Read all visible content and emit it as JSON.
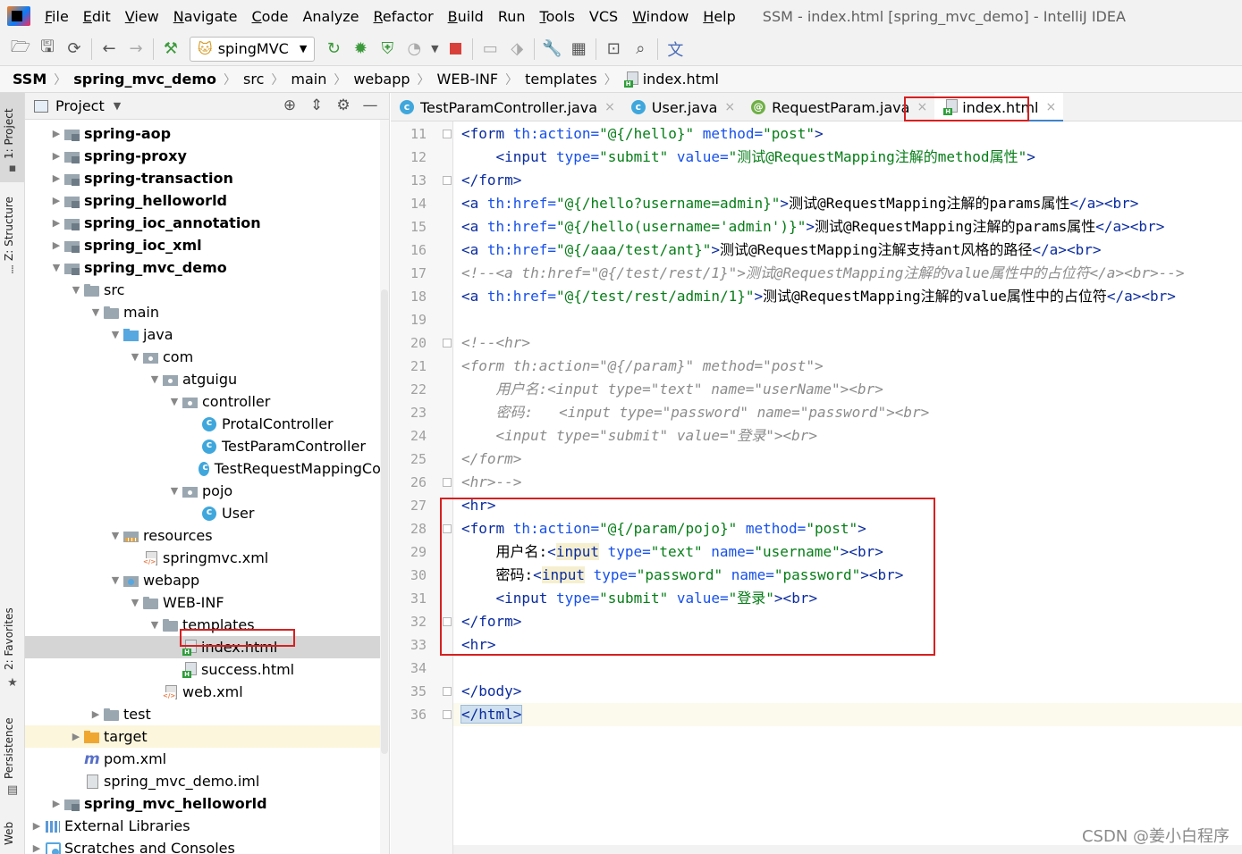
{
  "menubar": {
    "items": [
      {
        "label": "File",
        "u": "F",
        "rest": "ile"
      },
      {
        "label": "Edit",
        "u": "E",
        "rest": "dit"
      },
      {
        "label": "View",
        "u": "V",
        "rest": "iew"
      },
      {
        "label": "Navigate",
        "u": "N",
        "rest": "avigate"
      },
      {
        "label": "Code",
        "u": "C",
        "rest": "ode"
      },
      {
        "label": "Analyze",
        "u": "",
        "rest": "Analyze"
      },
      {
        "label": "Refactor",
        "u": "R",
        "rest": "efactor"
      },
      {
        "label": "Build",
        "u": "B",
        "rest": "uild"
      },
      {
        "label": "Run",
        "u": "",
        "rest": "Run"
      },
      {
        "label": "Tools",
        "u": "T",
        "rest": "ools"
      },
      {
        "label": "VCS",
        "u": "",
        "rest": "VCS"
      },
      {
        "label": "Window",
        "u": "W",
        "rest": "indow"
      },
      {
        "label": "Help",
        "u": "H",
        "rest": "elp"
      }
    ],
    "window_title": "SSM - index.html [spring_mvc_demo] - IntelliJ IDEA"
  },
  "toolbar": {
    "run_config": "spingMVC"
  },
  "breadcrumb": [
    "SSM",
    "spring_mvc_demo",
    "src",
    "main",
    "webapp",
    "WEB-INF",
    "templates",
    "index.html"
  ],
  "left_strip": {
    "project": "1: Project",
    "structure": "Z: Structure",
    "favorites": "2: Favorites",
    "persistence": "Persistence",
    "web": "Web"
  },
  "project_panel": {
    "title": "Project",
    "tree": [
      {
        "label": "spring-aop",
        "depth": 1,
        "arrow": "right",
        "icon": "module",
        "bold": true
      },
      {
        "label": "spring-proxy",
        "depth": 1,
        "arrow": "right",
        "icon": "module",
        "bold": true
      },
      {
        "label": "spring-transaction",
        "depth": 1,
        "arrow": "right",
        "icon": "module",
        "bold": true
      },
      {
        "label": "spring_helloworld",
        "depth": 1,
        "arrow": "right",
        "icon": "module",
        "bold": true
      },
      {
        "label": "spring_ioc_annotation",
        "depth": 1,
        "arrow": "right",
        "icon": "module",
        "bold": true
      },
      {
        "label": "spring_ioc_xml",
        "depth": 1,
        "arrow": "right",
        "icon": "module",
        "bold": true
      },
      {
        "label": "spring_mvc_demo",
        "depth": 1,
        "arrow": "down",
        "icon": "module",
        "bold": true
      },
      {
        "label": "src",
        "depth": 2,
        "arrow": "down",
        "icon": "folder"
      },
      {
        "label": "main",
        "depth": 3,
        "arrow": "down",
        "icon": "folder"
      },
      {
        "label": "java",
        "depth": 4,
        "arrow": "down",
        "icon": "javafolder"
      },
      {
        "label": "com",
        "depth": 5,
        "arrow": "down",
        "icon": "pkg"
      },
      {
        "label": "atguigu",
        "depth": 6,
        "arrow": "down",
        "icon": "pkg"
      },
      {
        "label": "controller",
        "depth": 7,
        "arrow": "down",
        "icon": "pkg"
      },
      {
        "label": "ProtalController",
        "depth": 8,
        "arrow": "",
        "icon": "cls"
      },
      {
        "label": "TestParamController",
        "depth": 8,
        "arrow": "",
        "icon": "cls"
      },
      {
        "label": "TestRequestMappingCon",
        "depth": 8,
        "arrow": "",
        "icon": "cls"
      },
      {
        "label": "pojo",
        "depth": 7,
        "arrow": "down",
        "icon": "pkg"
      },
      {
        "label": "User",
        "depth": 8,
        "arrow": "",
        "icon": "cls"
      },
      {
        "label": "resources",
        "depth": 4,
        "arrow": "down",
        "icon": "res"
      },
      {
        "label": "springmvc.xml",
        "depth": 5,
        "arrow": "",
        "icon": "xml"
      },
      {
        "label": "webapp",
        "depth": 4,
        "arrow": "down",
        "icon": "webapp"
      },
      {
        "label": "WEB-INF",
        "depth": 5,
        "arrow": "down",
        "icon": "folder"
      },
      {
        "label": "templates",
        "depth": 6,
        "arrow": "down",
        "icon": "folder"
      },
      {
        "label": "index.html",
        "depth": 7,
        "arrow": "",
        "icon": "html",
        "selected": true
      },
      {
        "label": "success.html",
        "depth": 7,
        "arrow": "",
        "icon": "html"
      },
      {
        "label": "web.xml",
        "depth": 6,
        "arrow": "",
        "icon": "xml"
      },
      {
        "label": "test",
        "depth": 3,
        "arrow": "right",
        "icon": "folder"
      },
      {
        "label": "target",
        "depth": 2,
        "arrow": "right",
        "icon": "target-folder",
        "highlight": true
      },
      {
        "label": "pom.xml",
        "depth": 2,
        "arrow": "",
        "icon": "pom"
      },
      {
        "label": "spring_mvc_demo.iml",
        "depth": 2,
        "arrow": "",
        "icon": "iml"
      },
      {
        "label": "spring_mvc_helloworld",
        "depth": 1,
        "arrow": "right",
        "icon": "module",
        "bold": true
      },
      {
        "label": "External Libraries",
        "depth": 0,
        "arrow": "right",
        "icon": "libs"
      },
      {
        "label": "Scratches and Consoles",
        "depth": 0,
        "arrow": "right",
        "icon": "scratch"
      }
    ]
  },
  "editor_tabs": [
    {
      "label": "TestParamController.java",
      "icon": "class"
    },
    {
      "label": "User.java",
      "icon": "class"
    },
    {
      "label": "RequestParam.java",
      "icon": "annotation"
    },
    {
      "label": "index.html",
      "icon": "html",
      "active": true
    }
  ],
  "code_lines": [
    {
      "num": "11",
      "segs": [
        [
          "tag",
          "<form "
        ],
        [
          "attr",
          "th:action="
        ],
        [
          "val",
          "\"@{/hello}\""
        ],
        [
          "attr",
          " method="
        ],
        [
          "val",
          "\"post\""
        ],
        [
          "tag",
          ">"
        ]
      ]
    },
    {
      "num": "12",
      "segs": [
        [
          "txt",
          "    "
        ],
        [
          "tag",
          "<input "
        ],
        [
          "attr",
          "type="
        ],
        [
          "val",
          "\"submit\""
        ],
        [
          "attr",
          " value="
        ],
        [
          "val",
          "\"测试@RequestMapping注解的method属性\""
        ],
        [
          "tag",
          ">"
        ]
      ]
    },
    {
      "num": "13",
      "segs": [
        [
          "tag",
          "</form>"
        ]
      ]
    },
    {
      "num": "14",
      "segs": [
        [
          "tag",
          "<a "
        ],
        [
          "attr",
          "th:href="
        ],
        [
          "val",
          "\"@{/hello?username=admin}\""
        ],
        [
          "tag",
          ">"
        ],
        [
          "txt",
          "测试@RequestMapping注解的params属性"
        ],
        [
          "tag",
          "</a><br>"
        ]
      ]
    },
    {
      "num": "15",
      "segs": [
        [
          "tag",
          "<a "
        ],
        [
          "attr",
          "th:href="
        ],
        [
          "val",
          "\"@{/hello(username='admin')}\""
        ],
        [
          "tag",
          ">"
        ],
        [
          "txt",
          "测试@RequestMapping注解的params属性"
        ],
        [
          "tag",
          "</a><br>"
        ]
      ]
    },
    {
      "num": "16",
      "segs": [
        [
          "tag",
          "<a "
        ],
        [
          "attr",
          "th:href="
        ],
        [
          "val",
          "\"@{/aaa/test/ant}\""
        ],
        [
          "tag",
          ">"
        ],
        [
          "txt",
          "测试@RequestMapping注解支持ant风格的路径"
        ],
        [
          "tag",
          "</a><br>"
        ]
      ]
    },
    {
      "num": "17",
      "segs": [
        [
          "cmt",
          "<!--<a th:href=\"@{/test/rest/1}\">测试@RequestMapping注解的value属性中的占位符</a><br>-->"
        ]
      ]
    },
    {
      "num": "18",
      "segs": [
        [
          "tag",
          "<a "
        ],
        [
          "attr",
          "th:href="
        ],
        [
          "val",
          "\"@{/test/rest/admin/1}\""
        ],
        [
          "tag",
          ">"
        ],
        [
          "txt",
          "测试@RequestMapping注解的value属性中的占位符"
        ],
        [
          "tag",
          "</a><br>"
        ]
      ]
    },
    {
      "num": "19",
      "segs": []
    },
    {
      "num": "20",
      "segs": [
        [
          "cmt",
          "<!--<hr>"
        ]
      ]
    },
    {
      "num": "21",
      "segs": [
        [
          "cmt",
          "<form th:action=\"@{/param}\" method=\"post\">"
        ]
      ]
    },
    {
      "num": "22",
      "segs": [
        [
          "cmt",
          "    用户名:<input type=\"text\" name=\"userName\"><br>"
        ]
      ]
    },
    {
      "num": "23",
      "segs": [
        [
          "cmt",
          "    密码:   <input type=\"password\" name=\"password\"><br>"
        ]
      ]
    },
    {
      "num": "24",
      "segs": [
        [
          "cmt",
          "    <input type=\"submit\" value=\"登录\"><br>"
        ]
      ]
    },
    {
      "num": "25",
      "segs": [
        [
          "cmt",
          "</form>"
        ]
      ]
    },
    {
      "num": "26",
      "segs": [
        [
          "cmt",
          "<hr>-->"
        ]
      ]
    },
    {
      "num": "27",
      "segs": [
        [
          "tag",
          "<hr>"
        ]
      ]
    },
    {
      "num": "28",
      "segs": [
        [
          "tag",
          "<form "
        ],
        [
          "attr",
          "th:action="
        ],
        [
          "val",
          "\"@{/param/pojo}\""
        ],
        [
          "attr",
          " method="
        ],
        [
          "val",
          "\"post\""
        ],
        [
          "tag",
          ">"
        ]
      ]
    },
    {
      "num": "29",
      "segs": [
        [
          "txt",
          "    用户名:"
        ],
        [
          "tag",
          "<"
        ],
        [
          "hl",
          "input"
        ],
        [
          "attr",
          " type="
        ],
        [
          "val",
          "\"text\""
        ],
        [
          "attr",
          " name="
        ],
        [
          "val",
          "\"username\""
        ],
        [
          "tag",
          "><br>"
        ]
      ]
    },
    {
      "num": "30",
      "segs": [
        [
          "txt",
          "    密码:"
        ],
        [
          "tag",
          "<"
        ],
        [
          "hl",
          "input"
        ],
        [
          "attr",
          " type="
        ],
        [
          "val",
          "\"password\""
        ],
        [
          "attr",
          " name="
        ],
        [
          "val",
          "\"password\""
        ],
        [
          "tag",
          "><br>"
        ]
      ]
    },
    {
      "num": "31",
      "segs": [
        [
          "txt",
          "    "
        ],
        [
          "tag",
          "<input "
        ],
        [
          "attr",
          "type="
        ],
        [
          "val",
          "\"submit\""
        ],
        [
          "attr",
          " value="
        ],
        [
          "val",
          "\"登录\""
        ],
        [
          "tag",
          "><br>"
        ]
      ]
    },
    {
      "num": "32",
      "segs": [
        [
          "tag",
          "</form>"
        ]
      ]
    },
    {
      "num": "33",
      "segs": [
        [
          "tag",
          "<hr>"
        ]
      ]
    },
    {
      "num": "34",
      "segs": []
    },
    {
      "num": "35",
      "segs": [
        [
          "tag",
          "</body>"
        ]
      ]
    },
    {
      "num": "36",
      "segs": [
        [
          "caret",
          "</html>"
        ]
      ],
      "current": true
    }
  ],
  "watermark": "CSDN @姜小白程序"
}
